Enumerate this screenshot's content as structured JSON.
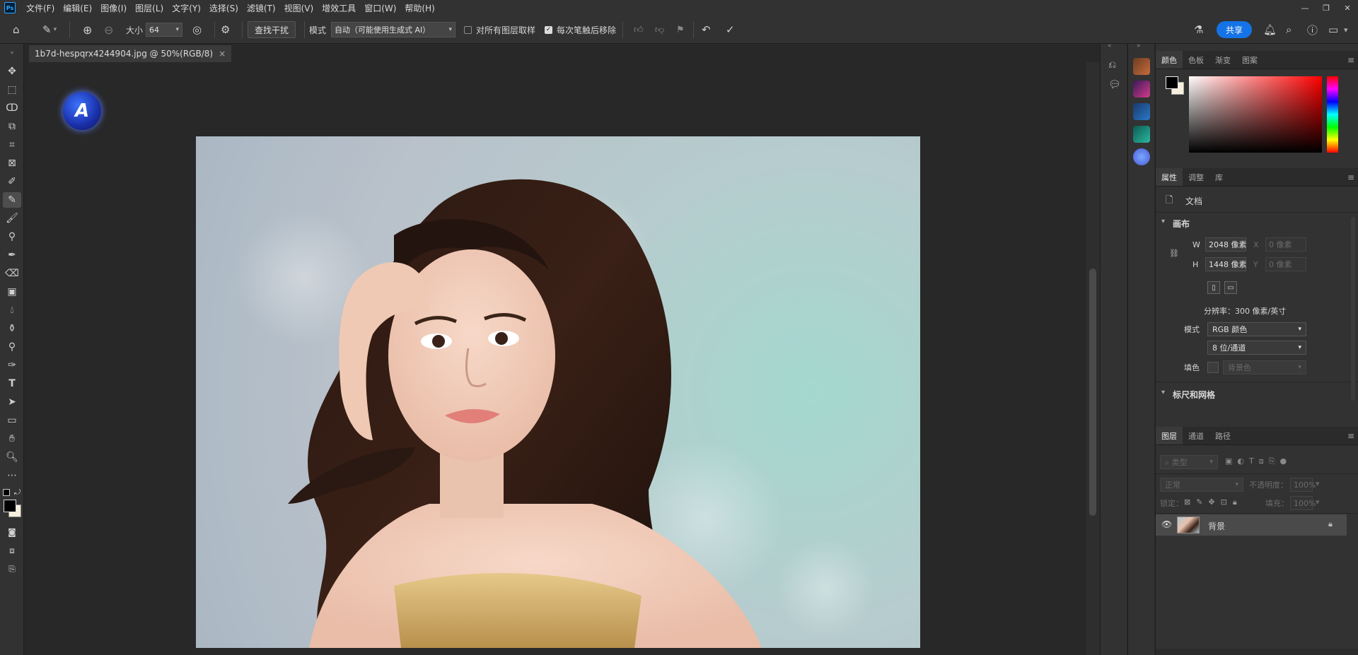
{
  "app": {
    "logo": "Ps"
  },
  "menu": [
    "文件(F)",
    "编辑(E)",
    "图像(I)",
    "图层(L)",
    "文字(Y)",
    "选择(S)",
    "滤镜(T)",
    "视图(V)",
    "增效工具",
    "窗口(W)",
    "帮助(H)"
  ],
  "window_controls": {
    "minimize": "—",
    "restore": "❐",
    "close": "✕"
  },
  "options": {
    "size_label": "大小",
    "size_value": "64",
    "find_button": "查找干扰",
    "mode_label": "模式",
    "mode_value": "自动（可能使用生成式 AI）",
    "sample_all_label": "对所有图层取样",
    "remove_after_label": "每次笔触后移除",
    "share_label": "共享"
  },
  "document": {
    "tab_title": "1b7d-hespqrx4244904.jpg @ 50%(RGB/8)",
    "tab_close": "×",
    "overlay_logo": "A"
  },
  "color_panel": {
    "tabs": [
      "颜色",
      "色板",
      "渐变",
      "图案"
    ],
    "colors": {
      "foreground": "#000000",
      "background": "#f5efdc"
    }
  },
  "properties_panel": {
    "tabs": [
      "属性",
      "调整",
      "库"
    ],
    "doc_label": "文档",
    "canvas_section": "画布",
    "w_label": "W",
    "w_value": "2048 像素",
    "h_label": "H",
    "h_value": "1448 像素",
    "x_label": "X",
    "x_value": "0 像素",
    "y_label": "Y",
    "y_value": "0 像素",
    "resolution": "分辨率：300 像素/英寸",
    "mode_label": "模式",
    "mode_value": "RGB 颜色",
    "depth_value": "8 位/通道",
    "fill_label": "填色",
    "fill_value": "背景色",
    "rulers_section": "标尺和网格"
  },
  "layers_panel": {
    "tabs": [
      "图层",
      "通道",
      "路径"
    ],
    "filter_placeholder": "类型",
    "blend_mode": "正常",
    "opacity_label": "不透明度：",
    "opacity_value": "100%",
    "lock_label": "锁定：",
    "fill_label": "填充：",
    "fill_value": "100%",
    "layers": [
      {
        "name": "背景",
        "locked": true,
        "visible": true
      }
    ]
  }
}
